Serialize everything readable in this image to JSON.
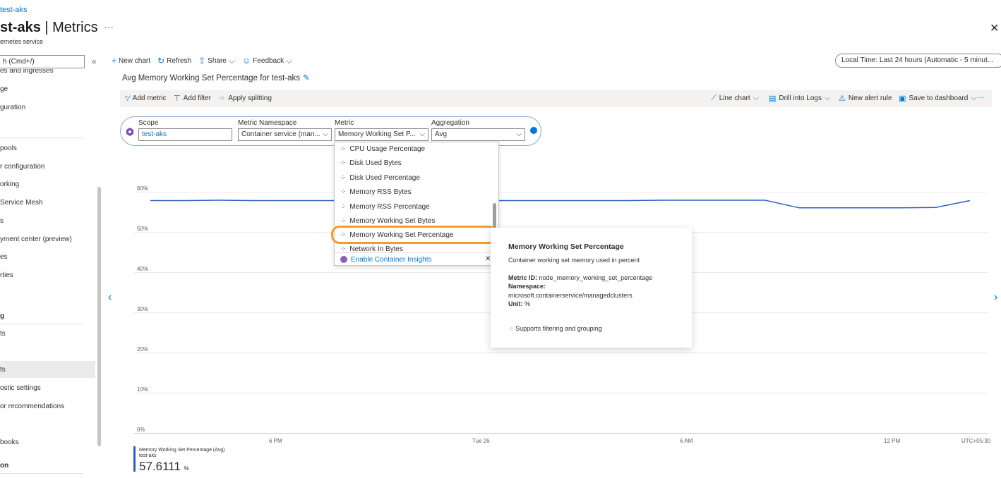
{
  "breadcrumb": "test-aks",
  "page": {
    "title_bold": "st-aks",
    "title_rest": " | Metrics",
    "subtitle": "ernetes service",
    "more": "···",
    "close": "✕"
  },
  "sidebar": {
    "search_placeholder": "h (Cmd+/)",
    "collapse": "«",
    "items": [
      "es and ingresses",
      "ge",
      "guration",
      "pools",
      "r configuration",
      "orking",
      "Service Mesh",
      "s",
      "yment center (preview)",
      "es",
      "rties",
      "g",
      "ts",
      "ts",
      "ostic settings",
      "or recommendations",
      "books",
      "on"
    ]
  },
  "toolbar": {
    "new_chart": "New chart",
    "refresh": "Refresh",
    "share": "Share",
    "feedback": "Feedback",
    "time_range": "Local Time: Last 24 hours (Automatic - 5 minut..."
  },
  "chart_title": "Avg Memory Working Set Percentage for test-aks",
  "cmdbar": {
    "add_metric": "Add metric",
    "add_filter": "Add filter",
    "apply_splitting": "Apply splitting",
    "line_chart": "Line chart",
    "drill_logs": "Drill into Logs",
    "new_alert": "New alert rule",
    "save_dashboard": "Save to dashboard",
    "more": "···"
  },
  "picker": {
    "scope_label": "Scope",
    "scope_value": "test-aks",
    "namespace_label": "Metric Namespace",
    "namespace_value": "Container service (man...",
    "metric_label": "Metric",
    "metric_value": "Memory Working Set P...",
    "aggregation_label": "Aggregation",
    "aggregation_value": "Avg"
  },
  "dropdown": {
    "items": [
      "CPU Usage Percentage",
      "Disk Used Bytes",
      "Disk Used Percentage",
      "Memory RSS Bytes",
      "Memory RSS Percentage",
      "Memory Working Set Bytes",
      "Memory Working Set Percentage",
      "Network In Bytes"
    ],
    "footer": "Enable Container Insights",
    "footer_close": "✕"
  },
  "tooltip": {
    "title": "Memory Working Set Percentage",
    "description": "Container working set memory used in percent",
    "metric_id_label": "Metric ID:",
    "metric_id": "node_memory_working_set_percentage",
    "namespace_label": "Namespace:",
    "namespace": "microsoft.containerservice/managedclusters",
    "unit_label": "Unit:",
    "unit": "%",
    "supports": "Supports filtering and grouping"
  },
  "chart_data": {
    "type": "line",
    "y_ticks": [
      "60%",
      "50%",
      "40%",
      "30%",
      "20%",
      "10%",
      "0%"
    ],
    "ylim": [
      0,
      60
    ],
    "x_ticks": [
      "6 PM",
      "Tue 26",
      "6 AM",
      "12 PM"
    ],
    "timezone": "UTC+05:30",
    "series": [
      {
        "name": "Memory Working Set Percentage (Avg)",
        "color": "#2d5fc2",
        "x": [
          0,
          1,
          2,
          3,
          4,
          5,
          6,
          7,
          8,
          9,
          10,
          11,
          12,
          13,
          14,
          15,
          16,
          17,
          18,
          19,
          20,
          21,
          22,
          23,
          24
        ],
        "values": [
          57.8,
          57.8,
          57.9,
          57.8,
          57.8,
          57.8,
          57.8,
          57.8,
          57.8,
          57.8,
          57.8,
          57.8,
          57.8,
          57.8,
          57.8,
          57.9,
          57.9,
          57.9,
          57.9,
          56.0,
          56.0,
          56.0,
          56.0,
          56.1,
          57.8
        ]
      }
    ],
    "legend_series_name": "Memory Working Set Percentage (Avg)",
    "legend_scope": "test-aks",
    "legend_value": "57.6111",
    "legend_unit": "%"
  }
}
